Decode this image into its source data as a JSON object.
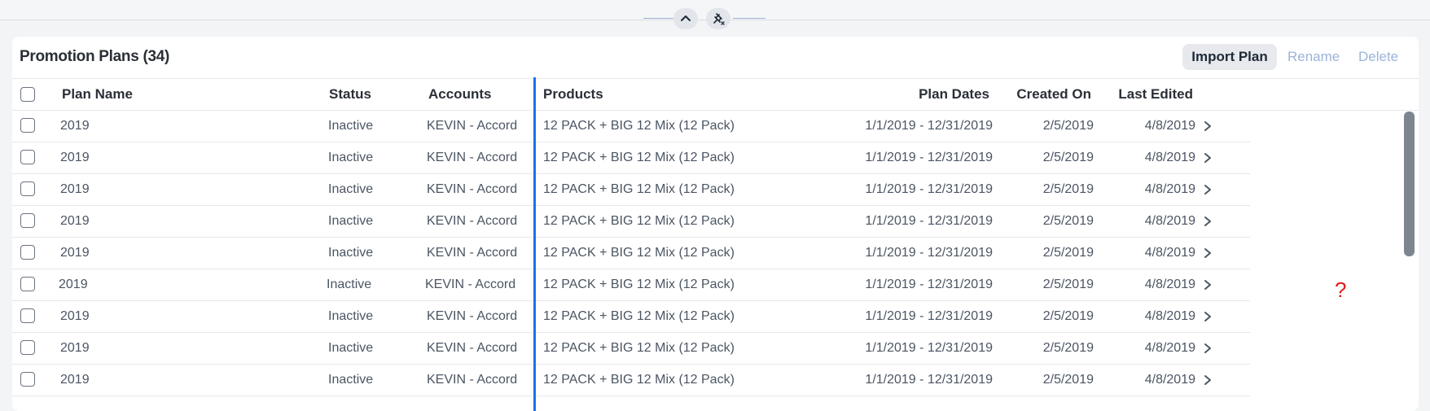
{
  "top": {
    "collapse_icon": "chevron-up-icon",
    "unpin_icon": "unpin-icon"
  },
  "panel": {
    "title": "Promotion Plans (34)",
    "actions": {
      "import": "Import Plan",
      "rename": "Rename",
      "delete": "Delete"
    }
  },
  "table": {
    "columns": {
      "plan_name": "Plan Name",
      "status": "Status",
      "accounts": "Accounts",
      "products": "Products",
      "plan_dates": "Plan Dates",
      "created_on": "Created On",
      "last_edited": "Last Edited"
    },
    "rows": [
      {
        "plan_name": "2019",
        "status": "Inactive",
        "accounts": "KEVIN - Accord",
        "products": "12 PACK + BIG 12 Mix (12 Pack)",
        "plan_dates": "1/1/2019 - 12/31/2019",
        "created_on": "2/5/2019",
        "last_edited": "4/8/2019"
      },
      {
        "plan_name": "2019",
        "status": "Inactive",
        "accounts": "KEVIN - Accord",
        "products": "12 PACK + BIG 12 Mix (12 Pack)",
        "plan_dates": "1/1/2019 - 12/31/2019",
        "created_on": "2/5/2019",
        "last_edited": "4/8/2019"
      },
      {
        "plan_name": "2019",
        "status": "Inactive",
        "accounts": "KEVIN - Accord",
        "products": "12 PACK + BIG 12 Mix (12 Pack)",
        "plan_dates": "1/1/2019 - 12/31/2019",
        "created_on": "2/5/2019",
        "last_edited": "4/8/2019"
      },
      {
        "plan_name": "2019",
        "status": "Inactive",
        "accounts": "KEVIN - Accord",
        "products": "12 PACK + BIG 12 Mix (12 Pack)",
        "plan_dates": "1/1/2019 - 12/31/2019",
        "created_on": "2/5/2019",
        "last_edited": "4/8/2019"
      },
      {
        "plan_name": "2019",
        "status": "Inactive",
        "accounts": "KEVIN - Accord",
        "products": "12 PACK + BIG 12 Mix (12 Pack)",
        "plan_dates": "1/1/2019 - 12/31/2019",
        "created_on": "2/5/2019",
        "last_edited": "4/8/2019"
      },
      {
        "plan_name": "2019",
        "status": "Inactive",
        "accounts": "KEVIN - Accord",
        "products": "12 PACK + BIG 12 Mix (12 Pack)",
        "plan_dates": "1/1/2019 - 12/31/2019",
        "created_on": "2/5/2019",
        "last_edited": "4/8/2019"
      },
      {
        "plan_name": "2019",
        "status": "Inactive",
        "accounts": "KEVIN - Accord",
        "products": "12 PACK + BIG 12 Mix (12 Pack)",
        "plan_dates": "1/1/2019 - 12/31/2019",
        "created_on": "2/5/2019",
        "last_edited": "4/8/2019"
      },
      {
        "plan_name": "2019",
        "status": "Inactive",
        "accounts": "KEVIN - Accord",
        "products": "12 PACK + BIG 12 Mix (12 Pack)",
        "plan_dates": "1/1/2019 - 12/31/2019",
        "created_on": "2/5/2019",
        "last_edited": "4/8/2019"
      },
      {
        "plan_name": "2019",
        "status": "Inactive",
        "accounts": "KEVIN - Accord",
        "products": "12 PACK + BIG 12 Mix (12 Pack)",
        "plan_dates": "1/1/2019 - 12/31/2019",
        "created_on": "2/5/2019",
        "last_edited": "4/8/2019"
      }
    ]
  },
  "overlay": {
    "question_mark": "?",
    "question_color": "#e31b1b"
  },
  "colors": {
    "accent": "#1a73e8",
    "link": "#9cb4d9"
  }
}
